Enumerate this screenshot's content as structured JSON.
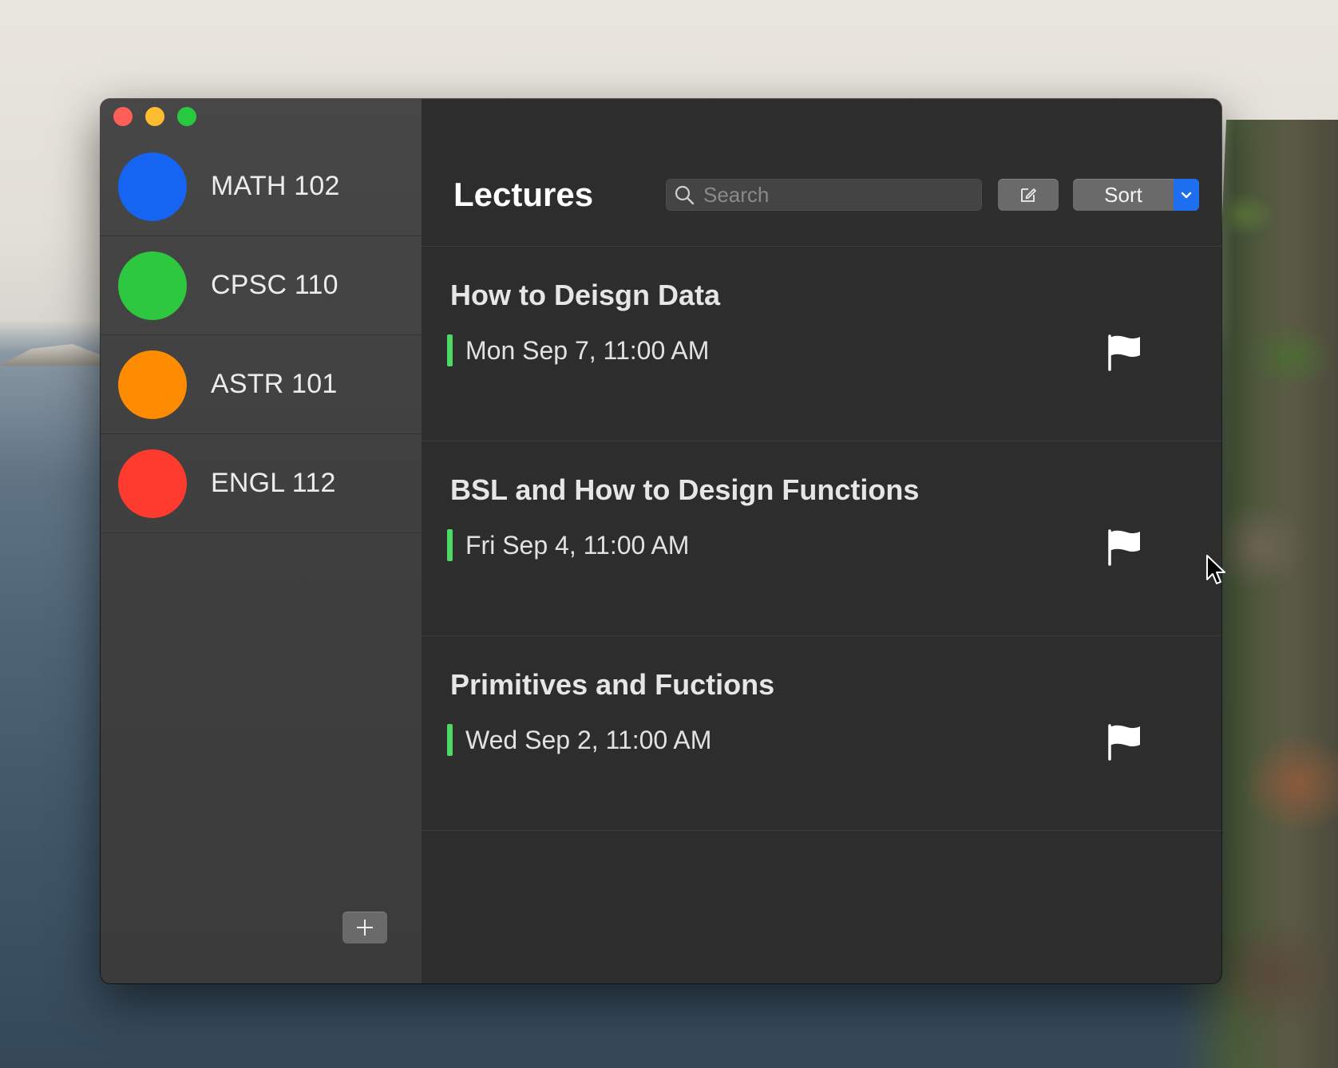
{
  "window": {
    "title": "Lectures"
  },
  "sidebar": {
    "courses": [
      {
        "label": "MATH 102",
        "color": "#1565f2"
      },
      {
        "label": "CPSC 110",
        "color": "#2ec840"
      },
      {
        "label": "ASTR 101",
        "color": "#ff8c00"
      },
      {
        "label": "ENGL 112",
        "color": "#ff3b30"
      }
    ],
    "add_icon": "plus-icon"
  },
  "toolbar": {
    "title": "Lectures",
    "search": {
      "placeholder": "Search",
      "value": "",
      "icon": "search-icon"
    },
    "compose_icon": "compose-icon",
    "sort_label": "Sort",
    "sort_chevron_icon": "chevron-down-icon",
    "accent_color": "#1e6ef0"
  },
  "lectures": [
    {
      "title": "How to Deisgn Data",
      "date": "Mon Sep 7, 11:00 AM",
      "flag_icon": "flag-icon"
    },
    {
      "title": "BSL and How to Design Functions",
      "date": "Fri Sep 4, 11:00 AM",
      "flag_icon": "flag-icon"
    },
    {
      "title": "Primitives and Fuctions",
      "date": "Wed Sep 2, 11:00 AM",
      "flag_icon": "flag-icon"
    }
  ],
  "status_color": "#4cd964"
}
